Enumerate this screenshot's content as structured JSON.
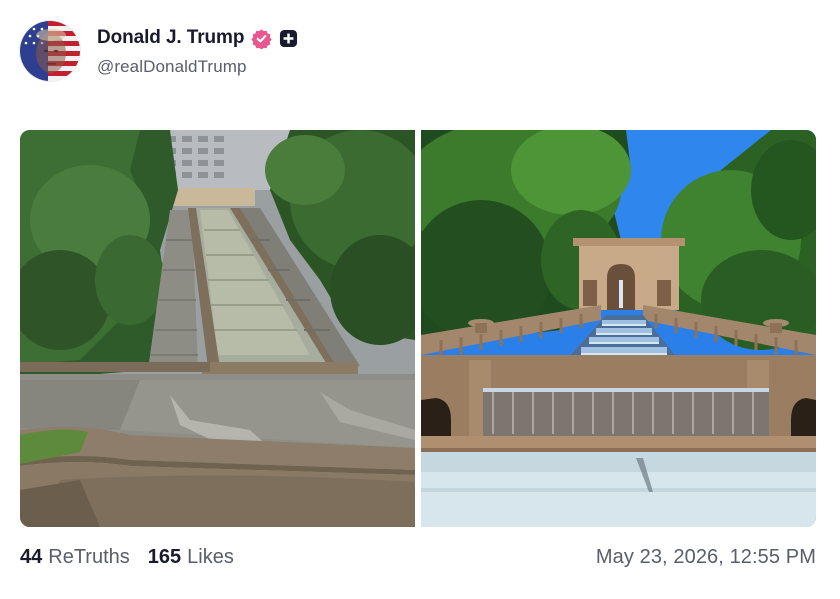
{
  "post": {
    "author": {
      "display_name": "Donald J. Trump",
      "handle": "@realDonaldTrump",
      "verified_icon": "verified-badge-icon",
      "verified_color": "#e8578f",
      "badge_icon": "plus-badge-icon"
    },
    "media": [
      {
        "icon": "photo-cascade-park-dry"
      },
      {
        "icon": "photo-cascade-park-fountain"
      }
    ],
    "stats": {
      "retruths_count": "44",
      "retruths_label": "ReTruths",
      "likes_count": "165",
      "likes_label": "Likes"
    },
    "timestamp": "May 23, 2026, 12:55 PM"
  }
}
